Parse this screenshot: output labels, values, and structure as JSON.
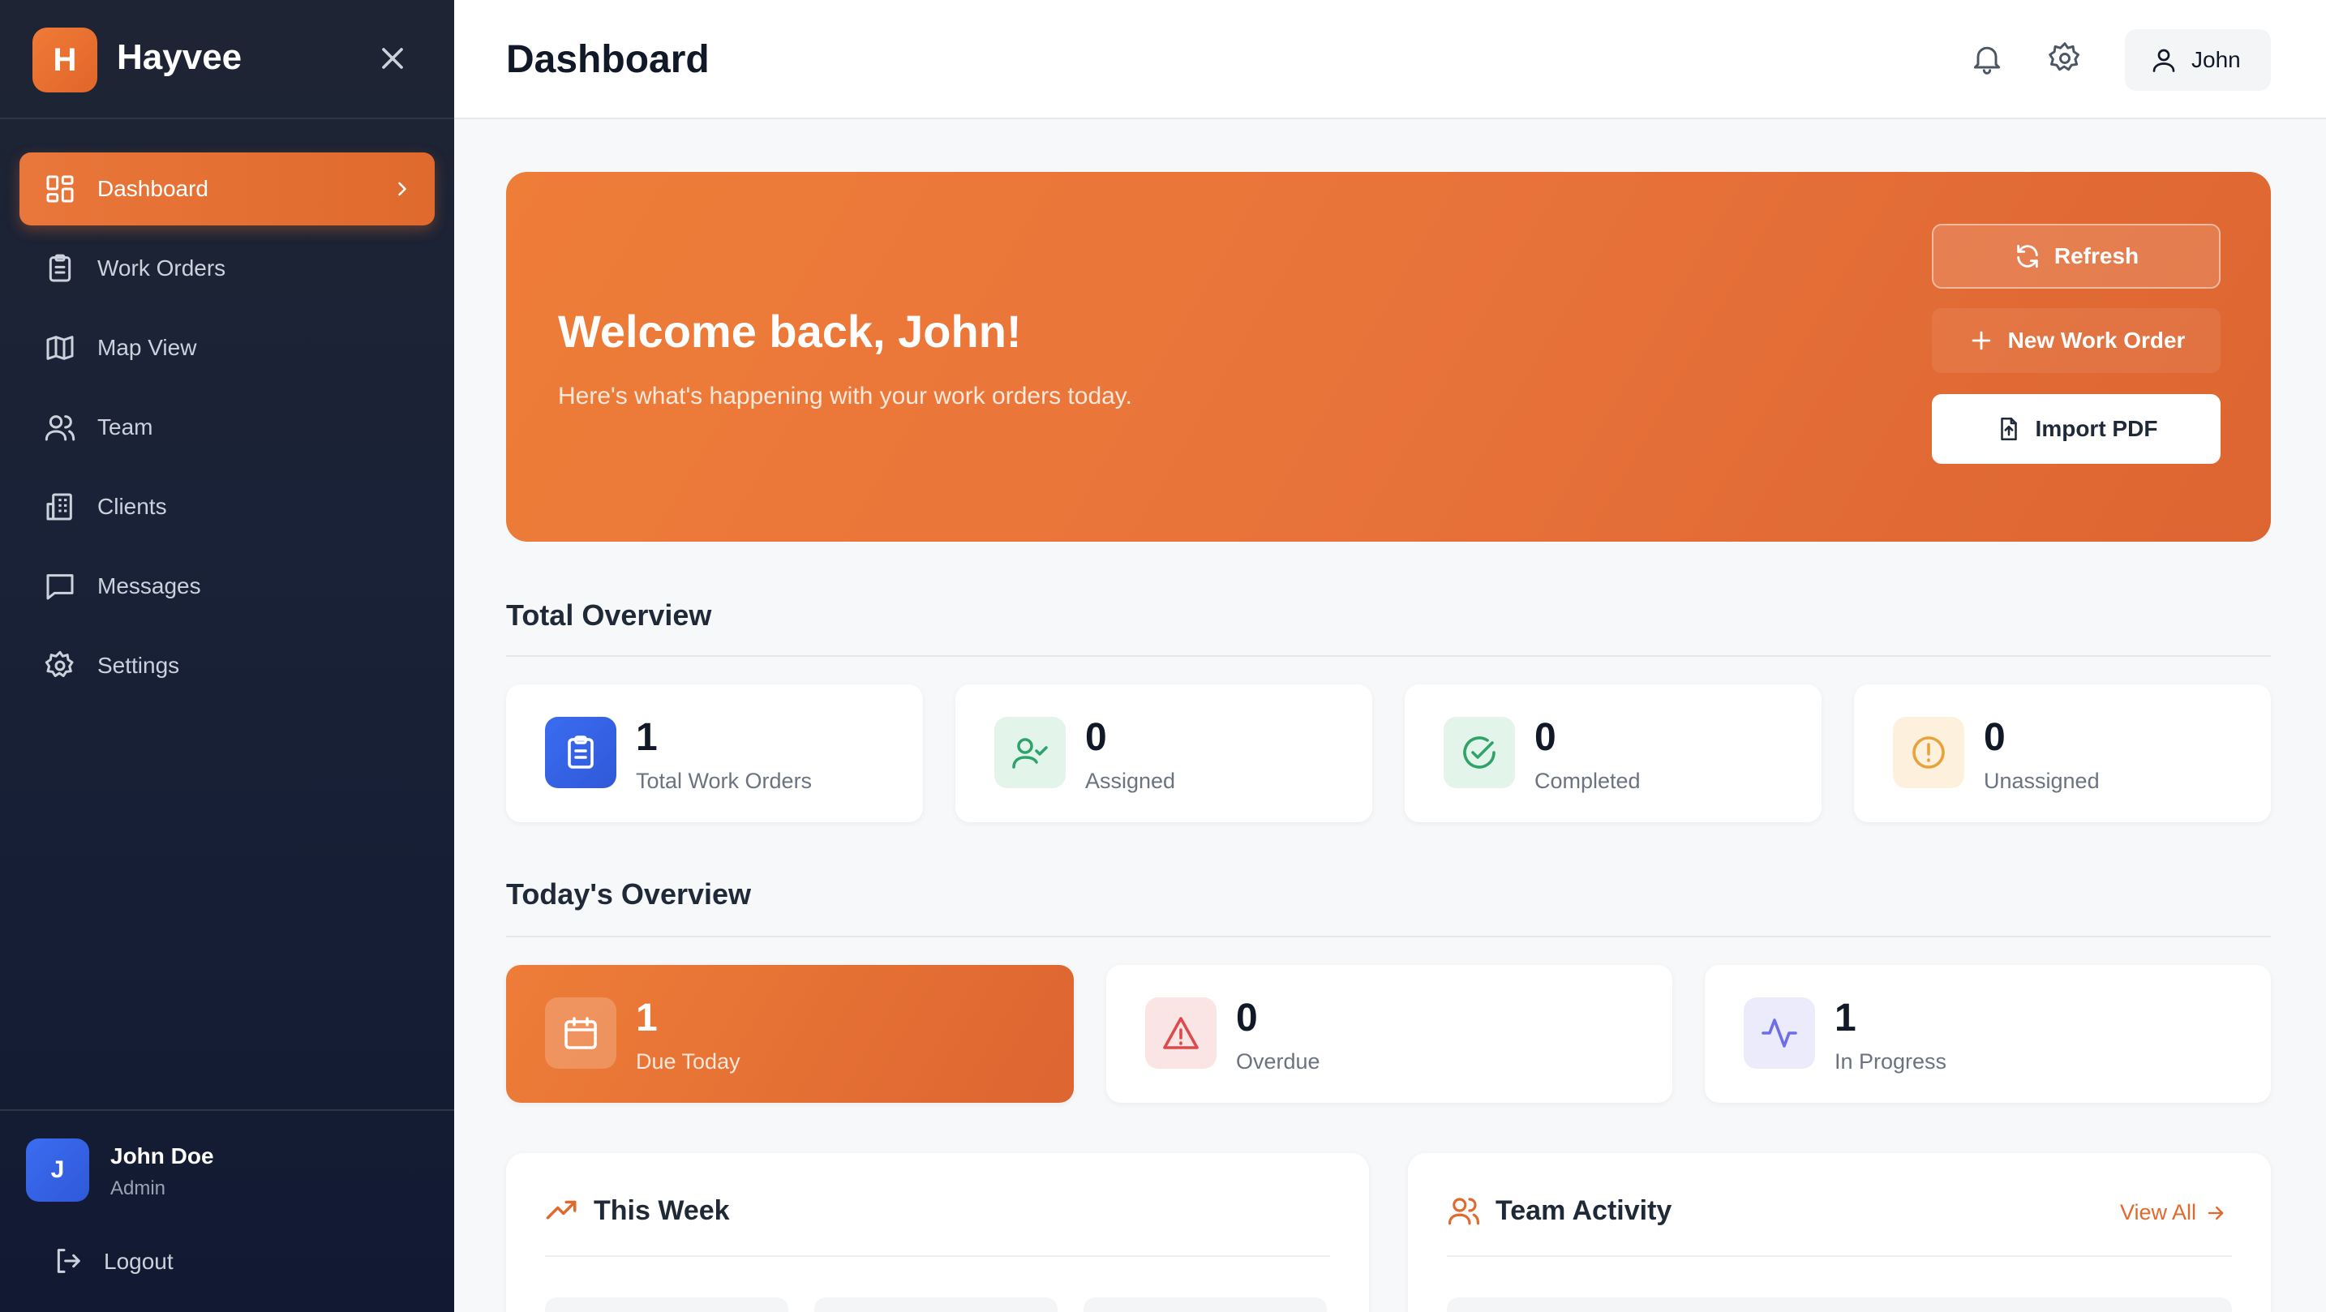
{
  "app": {
    "brand_initial": "H",
    "brand_name": "Hayvee"
  },
  "sidebar": {
    "items": [
      {
        "label": "Dashboard",
        "icon": "dashboard-icon",
        "active": true
      },
      {
        "label": "Work Orders",
        "icon": "clipboard-icon"
      },
      {
        "label": "Map View",
        "icon": "map-icon"
      },
      {
        "label": "Team",
        "icon": "users-icon"
      },
      {
        "label": "Clients",
        "icon": "building-icon"
      },
      {
        "label": "Messages",
        "icon": "message-icon"
      },
      {
        "label": "Settings",
        "icon": "gear-icon"
      }
    ],
    "user": {
      "initial": "J",
      "name": "John Doe",
      "role": "Admin"
    },
    "logout_label": "Logout"
  },
  "header": {
    "title": "Dashboard",
    "user_label": "John"
  },
  "hero": {
    "title": "Welcome back, John!",
    "subtitle": "Here's what's happening with your work orders today.",
    "refresh_label": "Refresh",
    "new_work_order_label": "New Work Order",
    "import_pdf_label": "Import PDF"
  },
  "total_overview": {
    "title": "Total Overview",
    "cards": [
      {
        "value": "1",
        "label": "Total Work Orders",
        "icon": "clipboard-icon",
        "color": "#3b6cf0"
      },
      {
        "value": "0",
        "label": "Assigned",
        "icon": "user-check-icon",
        "color": "#2fa36b"
      },
      {
        "value": "0",
        "label": "Completed",
        "icon": "check-circle-icon",
        "color": "#2fa36b"
      },
      {
        "value": "0",
        "label": "Unassigned",
        "icon": "alert-circle-icon",
        "color": "#e8a23a"
      }
    ]
  },
  "today_overview": {
    "title": "Today's Overview",
    "cards": [
      {
        "value": "1",
        "label": "Due Today",
        "icon": "calendar-icon"
      },
      {
        "value": "0",
        "label": "Overdue",
        "icon": "alert-triangle-icon",
        "color": "#dc4b4b"
      },
      {
        "value": "1",
        "label": "In Progress",
        "icon": "activity-icon",
        "color": "#6d6ee6"
      }
    ]
  },
  "panels": {
    "this_week": {
      "title": "This Week",
      "icon": "trending-up-icon"
    },
    "team_activity": {
      "title": "Team Activity",
      "icon": "users-icon",
      "link_label": "View All"
    }
  },
  "colors": {
    "accent": "#e9763a",
    "sidebar_bg": "#1a2237",
    "page_bg": "#f7f8fa"
  }
}
